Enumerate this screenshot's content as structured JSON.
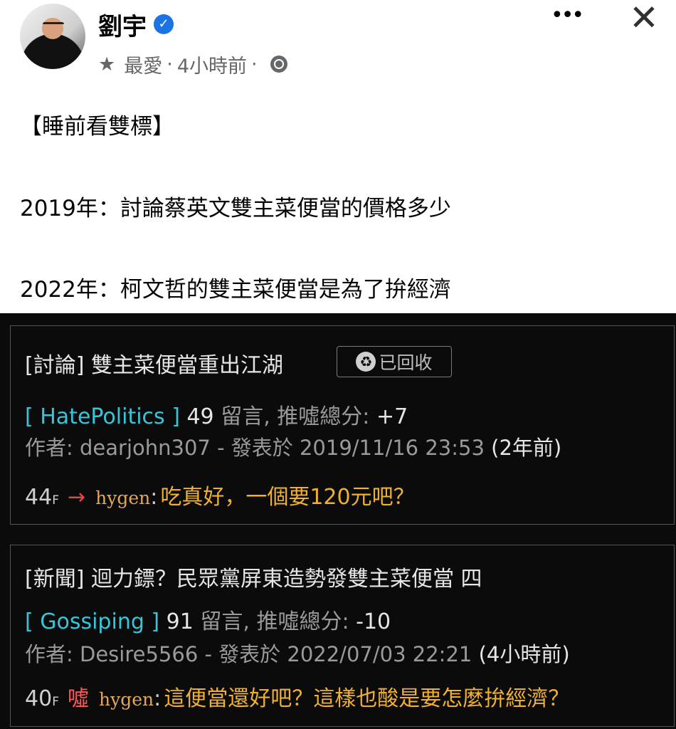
{
  "post": {
    "author": "劉宇",
    "verified_glyph": "✓",
    "meta": {
      "favorite": "最愛",
      "time": "4小時前",
      "separator": "·"
    },
    "more_glyph": "•••",
    "close_glyph": "✕",
    "lines": [
      "【睡前看雙標】",
      "2019年：討論蔡英文雙主菜便當的價格多少",
      "2022年：柯文哲的雙主菜便當是為了拚經濟"
    ]
  },
  "ptt": {
    "cards": [
      {
        "title": "[討論] 雙主菜便當重出江湖",
        "badge": "已回收",
        "board": "[ HatePolitics ]",
        "count": "49",
        "count_label": "留言, 推噓總分:",
        "score": "+7",
        "author_prefix": "作者:",
        "author": "dearjohn307",
        "posted_prefix": "- 發表於",
        "posted_at": "2019/11/16 23:53",
        "ago": "(2年前)",
        "floor": "44",
        "floor_suffix": "F",
        "tag": "→",
        "user": "hygen",
        "colon": ":",
        "message": "吃真好，一個要120元吧？"
      },
      {
        "title": "[新聞] 迴力鏢？民眾黨屏東造勢發雙主菜便當 四",
        "board": "[ Gossiping ]",
        "count": "91",
        "count_label": "留言, 推噓總分:",
        "score": "-10",
        "author_prefix": "作者:",
        "author": "Desire5566",
        "posted_prefix": "- 發表於",
        "posted_at": "2022/07/03 22:21",
        "ago": "(4小時前)",
        "floor": "40",
        "floor_suffix": "F",
        "tag": "噓",
        "user": "hygen",
        "colon": ":",
        "message": "這便當還好吧？這樣也酸是要怎麼拚經濟？"
      }
    ]
  }
}
